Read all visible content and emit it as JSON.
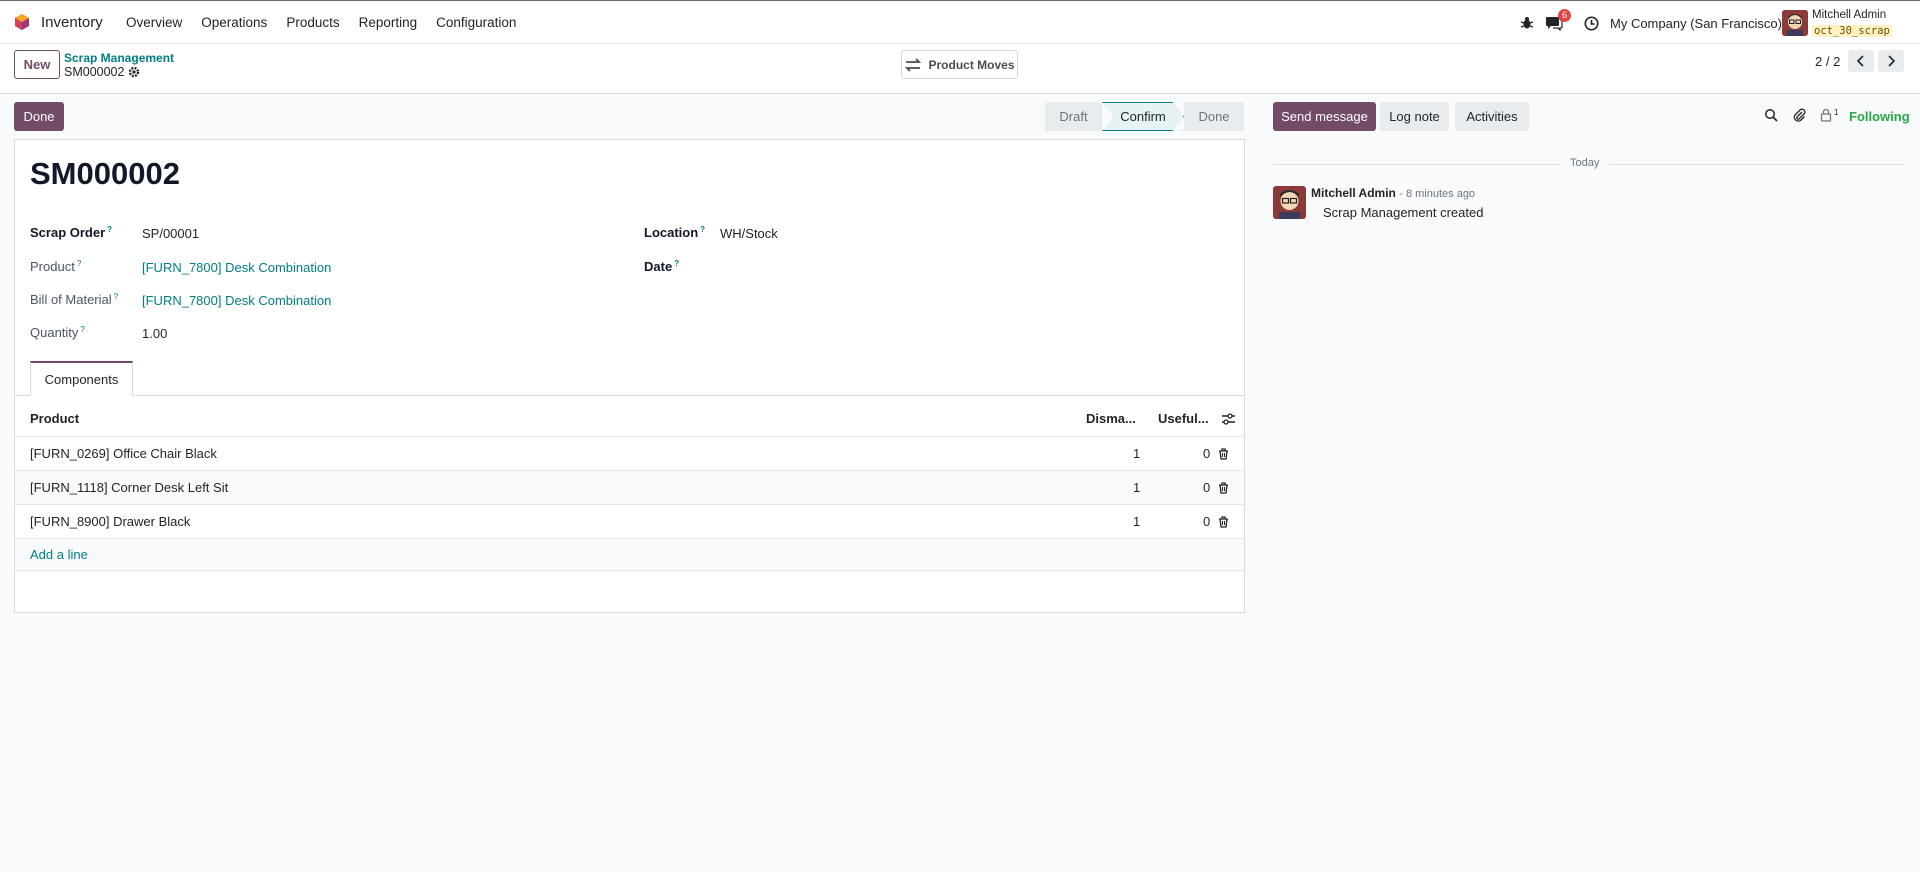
{
  "navbar": {
    "app_name": "Inventory",
    "menu": [
      "Overview",
      "Operations",
      "Products",
      "Reporting",
      "Configuration"
    ],
    "messages_badge": "6",
    "company": "My Company (San Francisco)",
    "user_name": "Mitchell Admin",
    "database": "oct_30_scrap"
  },
  "control": {
    "new_label": "New",
    "breadcrumb": "Scrap Management",
    "record_name": "SM000002",
    "smart_button": "Product Moves",
    "pager": "2 / 2"
  },
  "actions": {
    "done_label": "Done",
    "status": {
      "draft": "Draft",
      "confirm": "Confirm",
      "done": "Done"
    },
    "active_status": "Confirm"
  },
  "form": {
    "title": "SM000002",
    "fields": {
      "scrap_order_label": "Scrap Order",
      "scrap_order_value": "SP/00001",
      "product_label": "Product",
      "product_value": "[FURN_7800] Desk Combination",
      "bom_label": "Bill of Material",
      "bom_value": "[FURN_7800] Desk Combination",
      "quantity_label": "Quantity",
      "quantity_value": "1.00",
      "location_label": "Location",
      "location_value": "WH/Stock",
      "date_label": "Date",
      "help_mark": "?"
    },
    "tab_label": "Components",
    "table": {
      "columns": [
        "Product",
        "Disma...",
        "Useful..."
      ],
      "rows": [
        {
          "product": "[FURN_0269] Office Chair Black",
          "dismantled": "1",
          "useful": "0"
        },
        {
          "product": "[FURN_1118] Corner Desk Left Sit",
          "dismantled": "1",
          "useful": "0"
        },
        {
          "product": "[FURN_8900] Drawer Black",
          "dismantled": "1",
          "useful": "0"
        }
      ],
      "add_line": "Add a line"
    }
  },
  "chatter": {
    "send_message": "Send message",
    "log_note": "Log note",
    "activities": "Activities",
    "followers_count": "1",
    "following": "Following",
    "date_separator": "Today",
    "message": {
      "author": "Mitchell Admin",
      "time": "- 8 minutes ago",
      "body": "Scrap Management created"
    }
  },
  "colors": {
    "primary": "#714b67",
    "link": "#017e84",
    "following": "#28a745",
    "badge": "#e04646"
  }
}
